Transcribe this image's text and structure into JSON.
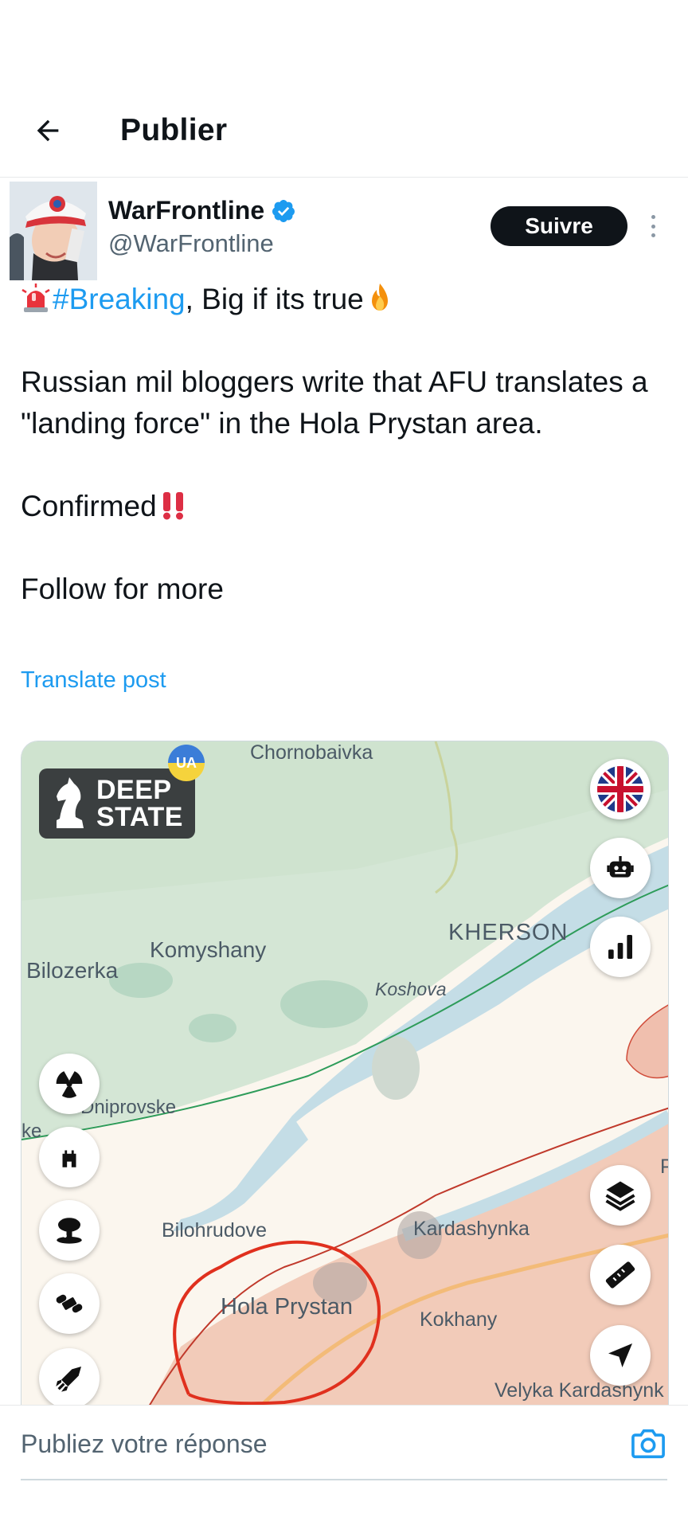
{
  "header": {
    "title": "Publier",
    "back_icon": "arrow-left-icon"
  },
  "author": {
    "display_name": "WarFrontline",
    "handle": "@WarFrontline",
    "verified_icon": "verified-badge-icon",
    "verified_color": "#1d9bf0"
  },
  "follow_label": "Suivre",
  "more_icon": "more-vertical-icon",
  "tweet": {
    "hashtag": "#Breaking",
    "line1_rest": ", Big if its true",
    "paragraph2": "Russian mil bloggers write that AFU translates a \"landing force\" in the Hola Prystan area.",
    "paragraph3": "Confirmed",
    "paragraph4": "Follow for more",
    "emoji": [
      "siren-emoji",
      "fire-emoji",
      "double-exclamation-emoji"
    ]
  },
  "translate_label": "Translate post",
  "map": {
    "logo_line1": "DEEP",
    "logo_line2": "STATE",
    "ua_badge": "UA",
    "labels": {
      "chornobaivka": "Chornobaivka",
      "kherson": "KHERSON",
      "komyshany": "Komyshany",
      "bilozerka": "Bilozerka",
      "koshova": "Koshova",
      "dniprovske": "Dniprovske",
      "ke": "ke",
      "bilohrudove": "Bilohrudove",
      "kardashynka": "Kardashynka",
      "hola_prystan": "Hola Prystan",
      "kokhany": "Kokhany",
      "velyka": "Velyka Kardashynk",
      "p": "P"
    },
    "right_buttons": [
      "uk-flag-icon",
      "robot-icon",
      "signal-bars-icon",
      "layers-icon",
      "ruler-icon",
      "navigation-arrow-icon"
    ],
    "left_buttons": [
      "radiation-icon",
      "castle-icon",
      "explosion-icon",
      "tank-tracks-icon",
      "missile-icon"
    ],
    "colors": {
      "land_green": "#d7e8d8",
      "occupied": "#f0c8b8",
      "water": "#c4dde6",
      "circle": "#e0301e"
    }
  },
  "reply": {
    "placeholder": "Publiez votre réponse",
    "camera_icon": "camera-icon",
    "accent": "#1d9bf0"
  }
}
